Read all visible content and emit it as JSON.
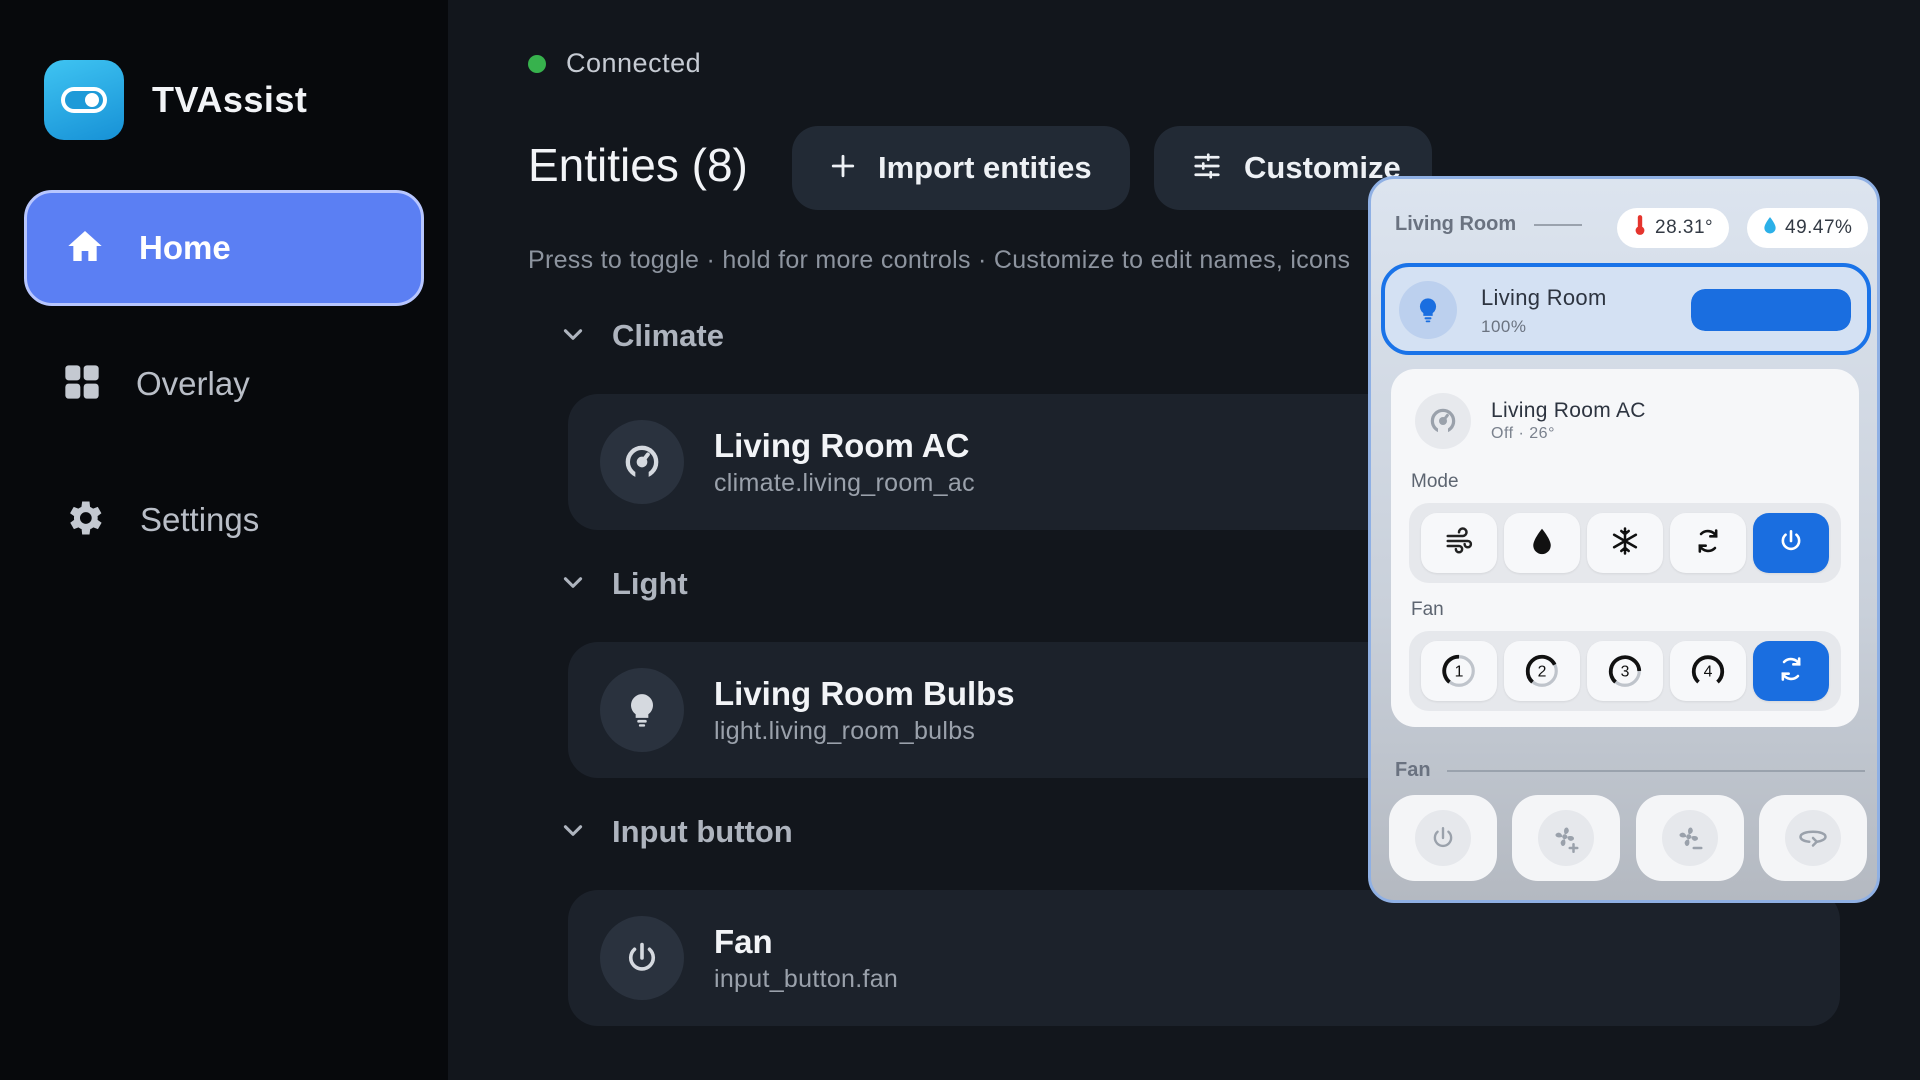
{
  "app": {
    "title": "TVAssist"
  },
  "sidebar": {
    "items": [
      {
        "label": "Home",
        "icon": "home-icon",
        "active": true
      },
      {
        "label": "Overlay",
        "icon": "grid-icon",
        "active": false
      },
      {
        "label": "Settings",
        "icon": "gear-icon",
        "active": false
      }
    ]
  },
  "status": {
    "text": "Connected",
    "color": "#37b24d"
  },
  "header": {
    "title": "Entities (8)",
    "import_label": "Import entities",
    "customize_label": "Customize",
    "hint": "Press to toggle · hold for more controls · Customize to edit names, icons"
  },
  "sections": [
    {
      "label": "Climate",
      "entity": {
        "name": "Living Room AC",
        "id": "climate.living_room_ac",
        "icon": "ac-dial-icon"
      }
    },
    {
      "label": "Light",
      "entity": {
        "name": "Living Room Bulbs",
        "id": "light.living_room_bulbs",
        "icon": "bulb-icon"
      }
    },
    {
      "label": "Input button",
      "entity": {
        "name": "Fan",
        "id": "input_button.fan",
        "icon": "power-icon"
      }
    }
  ],
  "overlay": {
    "room_label": "Living Room",
    "temperature": "28.31°",
    "humidity": "49.47%",
    "light": {
      "name": "Living Room",
      "value": "100%",
      "level": 1.0
    },
    "ac": {
      "name": "Living Room AC",
      "state": "Off · 26°",
      "mode_label": "Mode",
      "modes": [
        "fan-only-icon",
        "dry-icon",
        "cool-icon",
        "auto-icon",
        "power-icon"
      ],
      "active_mode": "power-icon",
      "fan_label": "Fan",
      "fan_speeds": [
        "1",
        "2",
        "3",
        "4"
      ],
      "active_fan": "auto"
    },
    "fan_section_label": "Fan",
    "fan_buttons": [
      "power-icon",
      "fan-plus-icon",
      "fan-minus-icon",
      "oscillate-icon"
    ]
  },
  "colors": {
    "accent": "#5b7ff3",
    "primary_blue": "#1a6ee0",
    "brand": "#2aa9e6"
  }
}
